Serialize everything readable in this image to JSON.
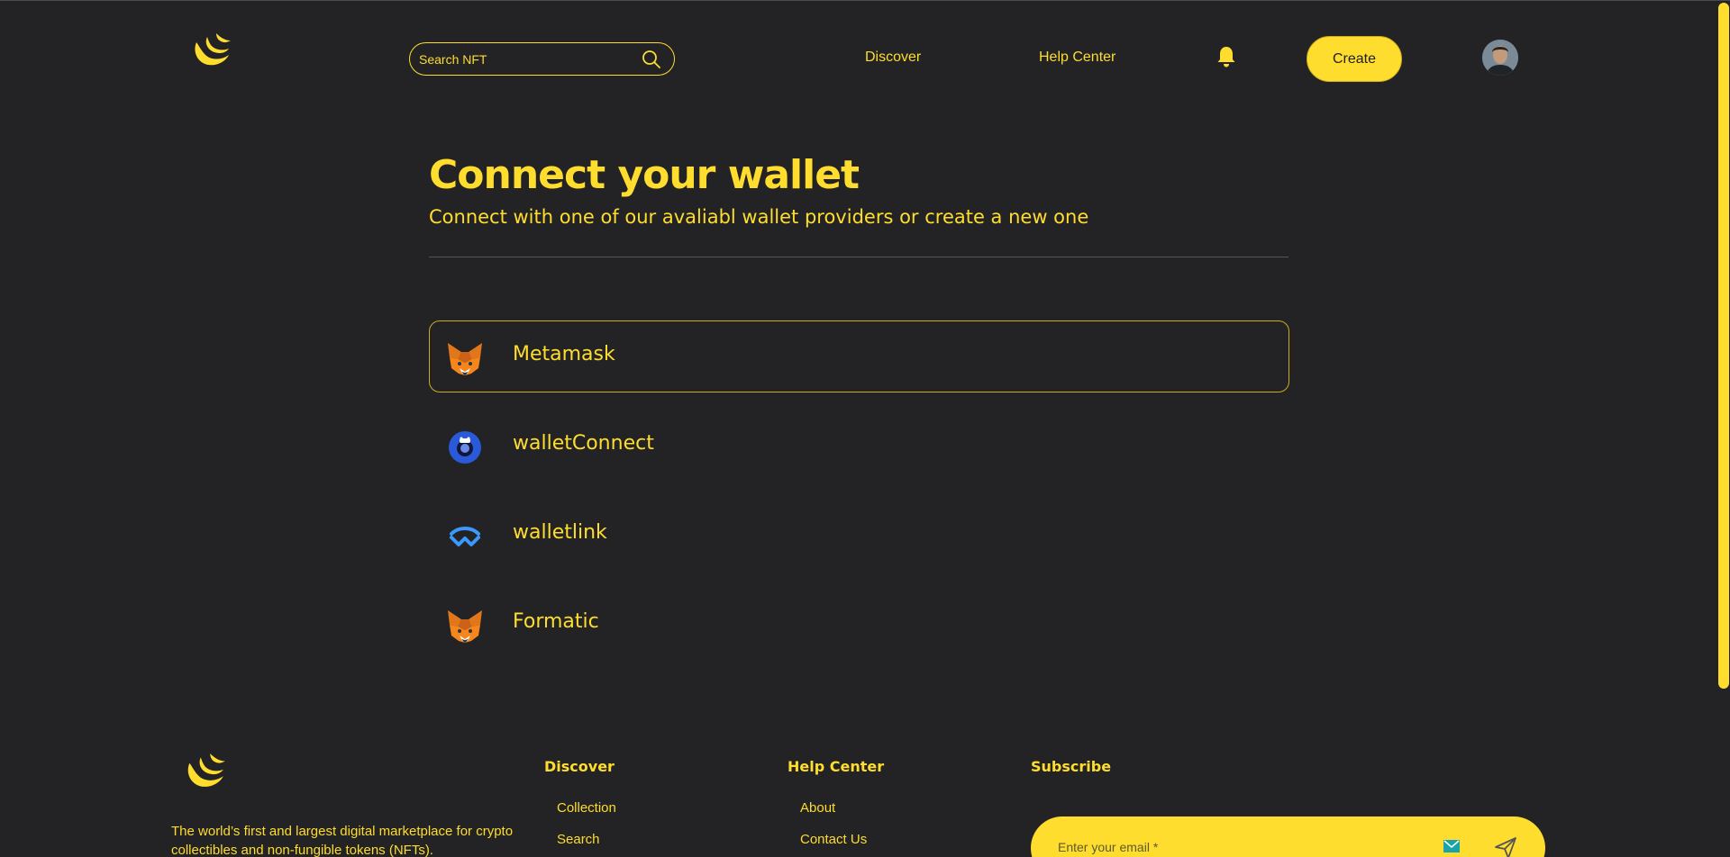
{
  "header": {
    "search_placeholder": "Search NFT",
    "nav": [
      "Discover",
      "Help Center"
    ],
    "create_label": "Create"
  },
  "main": {
    "title": "Connect your wallet",
    "subtitle": "Connect with one of our avaliabl wallet providers or create a new one",
    "wallets": [
      {
        "label": "Metamask",
        "icon": "metamask-fox-icon",
        "selected": true
      },
      {
        "label": "walletConnect",
        "icon": "walletconnect-icon",
        "selected": false
      },
      {
        "label": "walletlink",
        "icon": "walletlink-icon",
        "selected": false
      },
      {
        "label": "Formatic",
        "icon": "metamask-fox-icon",
        "selected": false
      }
    ]
  },
  "footer": {
    "description": "The world’s first and largest digital marketplace for crypto collectibles and non-fungible tokens (NFTs).",
    "columns": [
      {
        "heading": "Discover",
        "links": [
          "Collection",
          "Search"
        ]
      },
      {
        "heading": "Help Center",
        "links": [
          "About",
          "Contact Us"
        ]
      }
    ],
    "subscribe": {
      "heading": "Subscribe",
      "placeholder": "Enter your email *"
    }
  },
  "colors": {
    "background": "#232325",
    "accent": "#fedd2e"
  }
}
